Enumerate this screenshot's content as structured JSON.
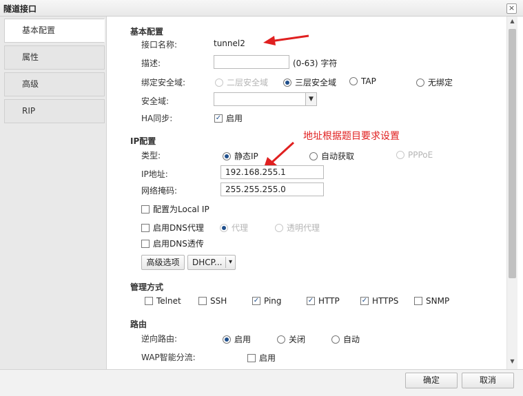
{
  "window": {
    "title": "隧道接口",
    "close_label": "×"
  },
  "sidebar": {
    "items": [
      {
        "label": "基本配置"
      },
      {
        "label": "属性"
      },
      {
        "label": "高级"
      },
      {
        "label": "RIP"
      }
    ]
  },
  "basic": {
    "section_title": "基本配置",
    "name_label": "接口名称:",
    "name_value": "tunnel2",
    "desc_label": "描述:",
    "desc_value": "",
    "desc_hint": "(0-63) 字符",
    "zone_bind_label": "绑定安全域:",
    "zone_bind_options": [
      "二层安全域",
      "三层安全域",
      "TAP",
      "无绑定"
    ],
    "zone_bind_selected": "三层安全域",
    "zone_label": "安全域:",
    "zone_value": "",
    "ha_label": "HA同步:",
    "ha_option": "启用",
    "ha_checked": true
  },
  "ip": {
    "section_title": "IP配置",
    "type_label": "类型:",
    "type_options": [
      "静态IP",
      "自动获取",
      "PPPoE"
    ],
    "type_selected": "静态IP",
    "addr_label": "IP地址:",
    "addr_value": "192.168.255.1",
    "mask_label": "网络掩码:",
    "mask_value": "255.255.255.0",
    "local_ip_label": "配置为Local IP",
    "local_ip_checked": false,
    "dns_proxy_label": "启用DNS代理",
    "dns_proxy_checked": false,
    "dns_proxy_modes": [
      "代理",
      "透明代理"
    ],
    "dns_transparent_label": "启用DNS透传",
    "dns_transparent_checked": false,
    "advanced_button": "高级选项",
    "dhcp_button": "DHCP...",
    "dhcp_arrow": "▾"
  },
  "management": {
    "section_title": "管理方式",
    "items": [
      {
        "label": "Telnet",
        "checked": false
      },
      {
        "label": "SSH",
        "checked": false
      },
      {
        "label": "Ping",
        "checked": true
      },
      {
        "label": "HTTP",
        "checked": true
      },
      {
        "label": "HTTPS",
        "checked": true
      },
      {
        "label": "SNMP",
        "checked": false
      }
    ]
  },
  "route": {
    "section_title": "路由",
    "reverse_label": "逆向路由:",
    "reverse_options": [
      "启用",
      "关闭",
      "自动"
    ],
    "reverse_selected": "启用",
    "wap_label": "WAP智能分流:",
    "wap_option": "启用",
    "wap_checked": false
  },
  "annotation": {
    "text": "地址根据题目要求设置",
    "color": "#e02020"
  },
  "footer": {
    "ok_label": "确定",
    "cancel_label": "取消"
  },
  "colors": {
    "accent": "#1f4f8c",
    "annotation": "#e02020"
  }
}
